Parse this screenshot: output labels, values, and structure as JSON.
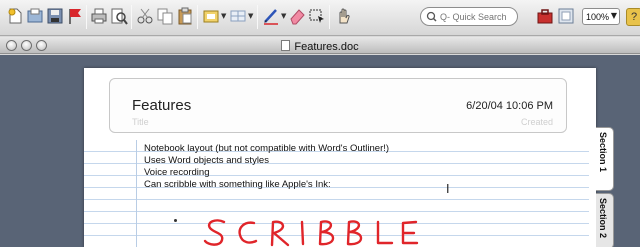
{
  "toolbar": {
    "icons": [
      "new-note-icon",
      "open-icon",
      "save-icon",
      "flag-icon",
      "print-icon",
      "print-preview-icon",
      "cut-icon",
      "copy-icon",
      "paste-icon",
      "insert-icon",
      "table-icon",
      "pen-icon",
      "eraser-icon",
      "select-icon",
      "hand-icon",
      "toolbox-icon",
      "view-icon"
    ],
    "search_placeholder": "Q- Quick Search",
    "zoom": "100%",
    "help": "?"
  },
  "window": {
    "title": "Features.doc"
  },
  "note": {
    "title": "Features",
    "title_label": "Title",
    "date": "6/20/04 10:06 PM",
    "date_label": "Created",
    "lines": [
      "Notebook layout (but not compatible with Word's Outliner!)",
      "Uses Word objects and styles",
      "Voice recording",
      "Can scribble with something like Apple's Ink:"
    ],
    "ink_text": "SCRIBBLE",
    "ink_color": "#e0252a"
  },
  "sections": [
    {
      "label": "Section 1"
    },
    {
      "label": "Section 2"
    }
  ],
  "colors": {
    "workspace": "#596476",
    "rule_lines": "#c5d7ec",
    "section_active": "#ffffff",
    "section_inactive": "#e6e6e6"
  }
}
